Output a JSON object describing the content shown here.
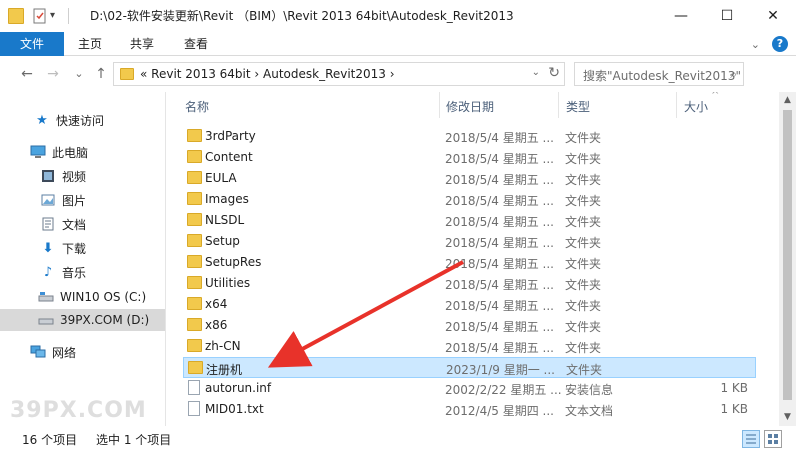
{
  "window": {
    "title": "D:\\02-软件安装更新\\Revit （BIM）\\Revit 2013 64bit\\Autodesk_Revit2013",
    "minimize_glyph": "—",
    "maximize_glyph": "☐",
    "close_glyph": "✕"
  },
  "ribbon": {
    "tabs": [
      "文件",
      "主页",
      "共享",
      "查看"
    ]
  },
  "nav": {
    "back": "←",
    "forward": "→",
    "recent": "⌄",
    "up": "↑",
    "breadcrumb": "«  Revit 2013 64bit  ›  Autodesk_Revit2013  ›",
    "search_placeholder": "搜索\"Autodesk_Revit2013\""
  },
  "sidebar": {
    "items": [
      {
        "label": "快速访问",
        "icon": "star-icon"
      },
      {
        "label": "此电脑",
        "icon": "computer-icon"
      },
      {
        "label": "视频",
        "icon": "video-icon"
      },
      {
        "label": "图片",
        "icon": "picture-icon"
      },
      {
        "label": "文档",
        "icon": "document-icon"
      },
      {
        "label": "下载",
        "icon": "download-icon"
      },
      {
        "label": "音乐",
        "icon": "music-icon"
      },
      {
        "label": "WIN10 OS (C:)",
        "icon": "drive-icon"
      },
      {
        "label": "39PX.COM (D:)",
        "icon": "drive-icon"
      },
      {
        "label": "网络",
        "icon": "network-icon"
      }
    ]
  },
  "columns": {
    "name": "名称",
    "date": "修改日期",
    "type": "类型",
    "size": "大小"
  },
  "files": [
    {
      "name": "3rdParty",
      "date": "2018/5/4 星期五 ...",
      "type": "文件夹",
      "size": "",
      "kind": "folder"
    },
    {
      "name": "Content",
      "date": "2018/5/4 星期五 ...",
      "type": "文件夹",
      "size": "",
      "kind": "folder"
    },
    {
      "name": "EULA",
      "date": "2018/5/4 星期五 ...",
      "type": "文件夹",
      "size": "",
      "kind": "folder"
    },
    {
      "name": "Images",
      "date": "2018/5/4 星期五 ...",
      "type": "文件夹",
      "size": "",
      "kind": "folder"
    },
    {
      "name": "NLSDL",
      "date": "2018/5/4 星期五 ...",
      "type": "文件夹",
      "size": "",
      "kind": "folder"
    },
    {
      "name": "Setup",
      "date": "2018/5/4 星期五 ...",
      "type": "文件夹",
      "size": "",
      "kind": "folder"
    },
    {
      "name": "SetupRes",
      "date": "2018/5/4 星期五 ...",
      "type": "文件夹",
      "size": "",
      "kind": "folder"
    },
    {
      "name": "Utilities",
      "date": "2018/5/4 星期五 ...",
      "type": "文件夹",
      "size": "",
      "kind": "folder"
    },
    {
      "name": "x64",
      "date": "2018/5/4 星期五 ...",
      "type": "文件夹",
      "size": "",
      "kind": "folder"
    },
    {
      "name": "x86",
      "date": "2018/5/4 星期五 ...",
      "type": "文件夹",
      "size": "",
      "kind": "folder"
    },
    {
      "name": "zh-CN",
      "date": "2018/5/4 星期五 ...",
      "type": "文件夹",
      "size": "",
      "kind": "folder"
    },
    {
      "name": "注册机",
      "date": "2023/1/9 星期一 ...",
      "type": "文件夹",
      "size": "",
      "kind": "folder",
      "selected": true
    },
    {
      "name": "autorun.inf",
      "date": "2002/2/22 星期五 ...",
      "type": "安装信息",
      "size": "1 KB",
      "kind": "file"
    },
    {
      "name": "MID01.txt",
      "date": "2012/4/5 星期四 ...",
      "type": "文本文档",
      "size": "1 KB",
      "kind": "file"
    }
  ],
  "status": {
    "count": "16 个项目",
    "selection": "选中 1 个项目"
  },
  "watermark": "39PX.COM",
  "colors": {
    "accent": "#1979ca",
    "folder": "#f2c94c",
    "selection": "#cce8ff",
    "annotation_arrow": "#e8322a"
  }
}
